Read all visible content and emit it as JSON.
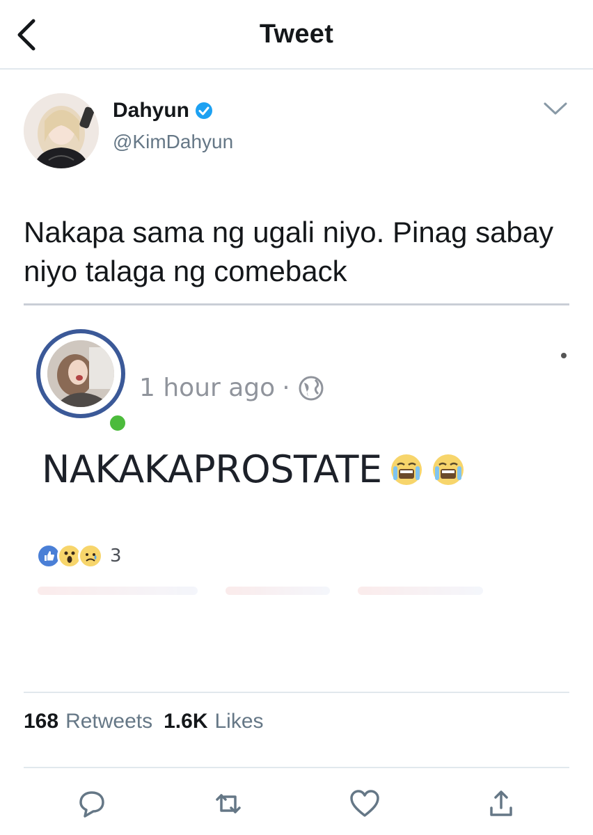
{
  "header": {
    "title": "Tweet",
    "back_icon": "chevron-left-icon"
  },
  "author": {
    "display_name": "Dahyun",
    "handle": "@KimDahyun",
    "verified": true,
    "verified_color": "#1da1f2"
  },
  "tweet": {
    "text": "Nakapa sama ng ugali niyo. Pinag sabay niyo talaga ng comeback"
  },
  "embedded_post": {
    "time": "1 hour ago",
    "separator": "·",
    "privacy_icon": "globe-icon",
    "text": "NAKAKAPROSTATE",
    "emojis": [
      "crying-face-emoji",
      "crying-face-emoji"
    ],
    "reactions": [
      "like-reaction",
      "wow-reaction",
      "sad-reaction"
    ],
    "reaction_count": "3",
    "online_color": "#4cbb3c",
    "ring_color": "#3b5998"
  },
  "stats": {
    "retweets_count": "168",
    "retweets_label": "Retweets",
    "likes_count": "1.6K",
    "likes_label": "Likes"
  },
  "actions": [
    "reply-icon",
    "retweet-icon",
    "like-icon",
    "share-icon"
  ],
  "colors": {
    "text": "#14171a",
    "secondary": "#657786",
    "divider": "#e1e8ed"
  }
}
